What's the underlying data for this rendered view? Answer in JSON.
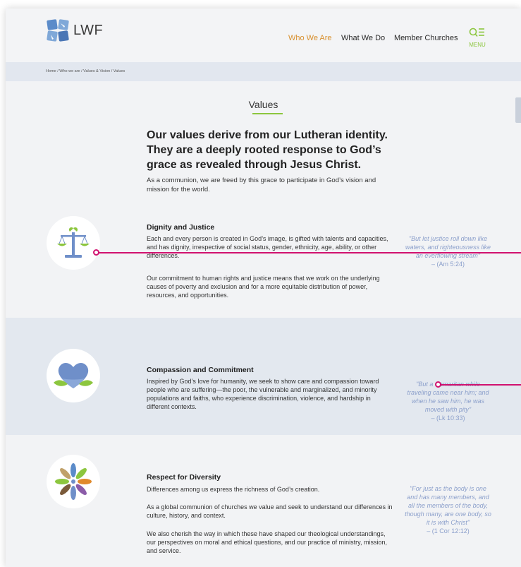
{
  "header": {
    "logo_text": "LWF",
    "nav": [
      {
        "label": "Who We Are",
        "active": true
      },
      {
        "label": "What We Do",
        "active": false
      },
      {
        "label": "Member Churches",
        "active": false
      }
    ],
    "menu_label": "MENU",
    "menu_icon": "search-menu-icon"
  },
  "breadcrumb": "Home / Who we are / Values & Vision / Values",
  "page": {
    "title": "Values",
    "lead": "Our values derive from our Lutheran identity. They are a deeply rooted response to God’s grace as revealed through Jesus Christ.",
    "intro": "As a communion, we are freed by this grace to participate in God’s vision and mission for the world."
  },
  "values": [
    {
      "icon": "scales-icon",
      "title": "Dignity and Justice",
      "paragraphs": [
        "Each and every person is created in God’s image, is gifted with talents and capacities, and has dignity, irrespective of social status, gender, ethnicity, age, ability, or other differences.",
        "Our commitment to human rights and justice means that we work on the underlying causes of poverty and exclusion and for a more equitable distribution of power, resources, and opportunities."
      ],
      "quote": "\"But let justice roll down like waters, and righteousness like an everflowing stream\"",
      "cite": "– (Am 5:24)"
    },
    {
      "icon": "heart-icon",
      "title": "Compassion and Commitment",
      "paragraphs": [
        "Inspired by God’s love for humanity, we seek to show care and compassion toward people who are suffering—the poor, the vulnerable and marginalized, and minority populations and faiths, who experience discrimination, violence, and hardship in different contexts."
      ],
      "quote": "\"But a Samaritan while traveling came near him; and when he saw him, he was moved with pity\"",
      "cite": "– (Lk 10:33)"
    },
    {
      "icon": "diversity-icon",
      "title": "Respect for Diversity",
      "paragraphs": [
        "Differences among us express the richness of God’s creation.",
        "As a global communion of churches we value and seek to understand our differences in culture, history, and context.",
        "We also cherish the way in which these have shaped our theological understandings, our perspectives on moral and ethical questions, and our practice of ministry, mission, and service."
      ],
      "quote": "\"For just as the body is one and has many members, and all the members of the body, though many, are one body, so it is with Christ\"",
      "cite": "– (1 Cor 12:12)"
    }
  ],
  "colors": {
    "accent_green": "#8cc63e",
    "nav_active": "#d8902e",
    "quote_blue": "#8b9fcb",
    "hotspot": "#d1126f",
    "band_blue": "#e3e8ef"
  }
}
